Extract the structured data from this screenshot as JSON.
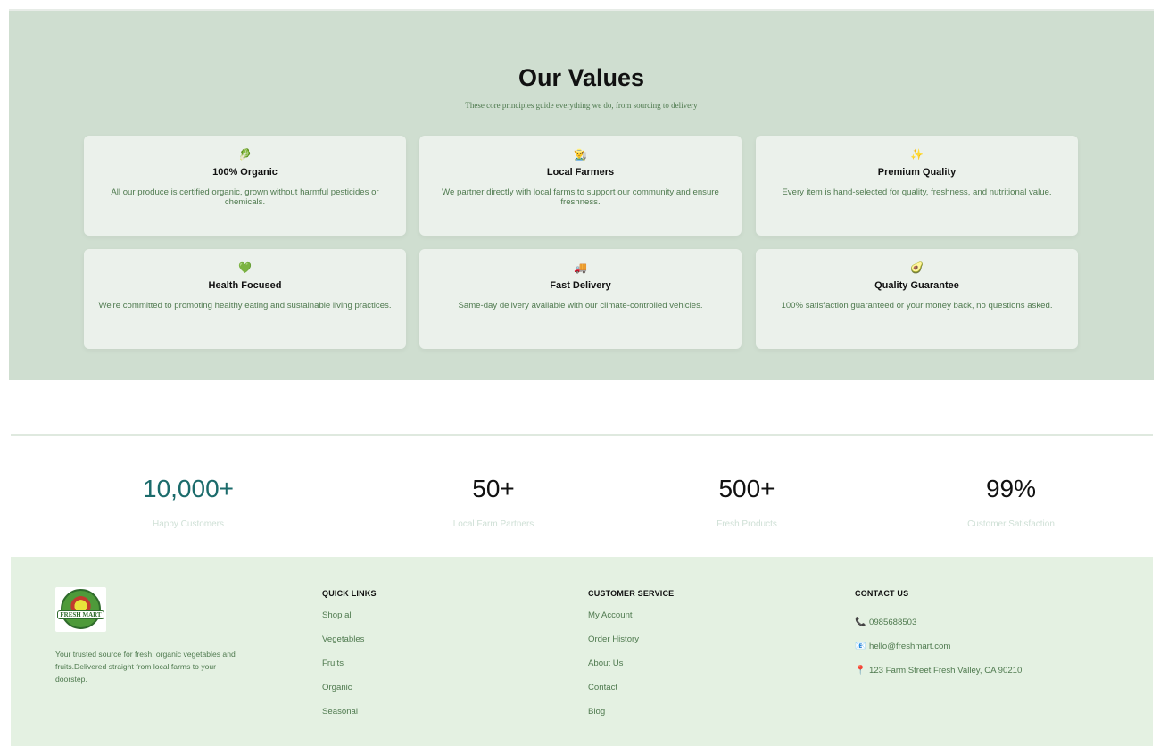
{
  "values": {
    "title": "Our Values",
    "subtitle": "These core principles guide everything we do, from sourcing to delivery",
    "cards": [
      {
        "icon": "🥬",
        "icon_name": "leaf-icon",
        "title": "100% Organic",
        "desc": "All our produce is certified organic, grown without harmful pesticides or chemicals."
      },
      {
        "icon": "👨‍🌾",
        "icon_name": "farmer-icon",
        "title": "Local Farmers",
        "desc": "We partner directly with local farms to support our community and ensure freshness."
      },
      {
        "icon": "✨",
        "icon_name": "sparkle-icon",
        "title": "Premium Quality",
        "desc": "Every item is hand-selected for quality, freshness, and nutritional value."
      },
      {
        "icon": "💚",
        "icon_name": "heart-icon",
        "title": "Health Focused",
        "desc": "We're committed to promoting healthy eating and sustainable living practices."
      },
      {
        "icon": "🚚",
        "icon_name": "truck-icon",
        "title": "Fast Delivery",
        "desc": "Same-day delivery available with our climate-controlled vehicles."
      },
      {
        "icon": "🥑",
        "icon_name": "avocado-icon",
        "title": "Quality Guarantee",
        "desc": "100% satisfaction guaranteed or your money back, no questions asked."
      }
    ]
  },
  "stats": [
    {
      "value": "10,000+",
      "label": "Happy Customers"
    },
    {
      "value": "50+",
      "label": "Local Farm Partners"
    },
    {
      "value": "500+",
      "label": "Fresh Products"
    },
    {
      "value": "99%",
      "label": "Customer Satisfaction"
    }
  ],
  "footer": {
    "logo_text": "FRESH MART",
    "tagline": "Your trusted source for fresh, organic vegetables and fruits.Delivered straight from local farms to your doorstep.",
    "quick_links": {
      "title": "QUICK LINKS",
      "items": [
        "Shop all",
        "Vegetables",
        "Fruits",
        "Organic",
        "Seasonal"
      ]
    },
    "customer_service": {
      "title": "CUSTOMER SERVICE",
      "items": [
        "My Account",
        "Order History",
        "About Us",
        "Contact",
        "Blog"
      ]
    },
    "contact": {
      "title": "CONTACT US",
      "phone_icon": "📞",
      "phone": "0985688503",
      "email_icon": "📧",
      "email": "hello@freshmart.com",
      "address_icon": "📍",
      "address": "123 Farm Street Fresh Valley, CA 90210"
    }
  },
  "colors": {
    "values_bg": "#cfded0",
    "card_bg": "#ebf1eb",
    "footer_bg": "#e4f1e2",
    "accent_text": "#4f7a4f",
    "stat_accent": "#1b6b6b"
  }
}
